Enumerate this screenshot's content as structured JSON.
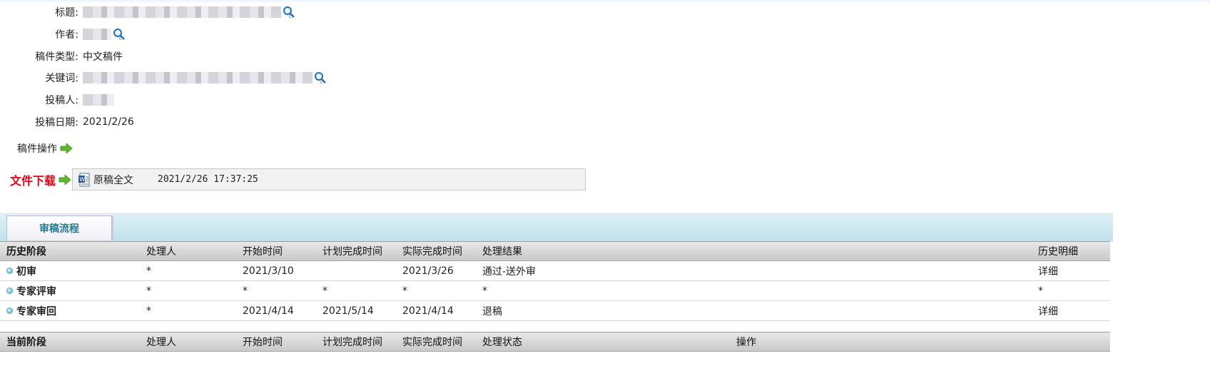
{
  "fields": [
    {
      "label": "标题:",
      "value": "",
      "blurred": true,
      "has_search": true
    },
    {
      "label": "作者:",
      "value": "",
      "blurred": true,
      "has_search": true
    },
    {
      "label": "稿件类型:",
      "value": "中文稿件",
      "blurred": false,
      "has_search": false
    },
    {
      "label": "关键词:",
      "value": "",
      "blurred": true,
      "has_search": true
    },
    {
      "label": "投稿人:",
      "value": "",
      "blurred": true,
      "has_search": false
    },
    {
      "label": "投稿日期:",
      "value": "2021/2/26",
      "blurred": false,
      "has_search": false
    }
  ],
  "operations": {
    "label": "稿件操作"
  },
  "download": {
    "label": "文件下载",
    "file_name": "原稿全文",
    "file_time": "2021/2/26 17:37:25"
  },
  "tab": {
    "label": "审稿流程"
  },
  "history": {
    "headers": [
      "历史阶段",
      "处理人",
      "开始时间",
      "计划完成时间",
      "实际完成时间",
      "处理结果",
      "历史明细"
    ],
    "rows": [
      {
        "stage": "初审",
        "handler": "*",
        "start": "2021/3/10",
        "planned": "",
        "actual": "2021/3/26",
        "result": "通过-送外审",
        "detail": "详细"
      },
      {
        "stage": "专家评审",
        "handler": "*",
        "start": "*",
        "planned": "*",
        "actual": "*",
        "result": "*",
        "detail": "*"
      },
      {
        "stage": "专家审回",
        "handler": "*",
        "start": "2021/4/14",
        "planned": "2021/5/14",
        "actual": "2021/4/14",
        "result": "退稿",
        "detail": "详细"
      }
    ]
  },
  "current": {
    "headers": [
      "当前阶段",
      "处理人",
      "开始时间",
      "计划完成时间",
      "实际完成时间",
      "处理状态",
      "操作"
    ]
  },
  "colors": {
    "download_label": "#e60012",
    "tab_text": "#2b7a94",
    "band": "#bfe2ec",
    "arrow": "#5cb82e"
  },
  "icons": [
    "search-icon",
    "arrow-right-icon",
    "word-doc-icon",
    "bullet-icon"
  ]
}
